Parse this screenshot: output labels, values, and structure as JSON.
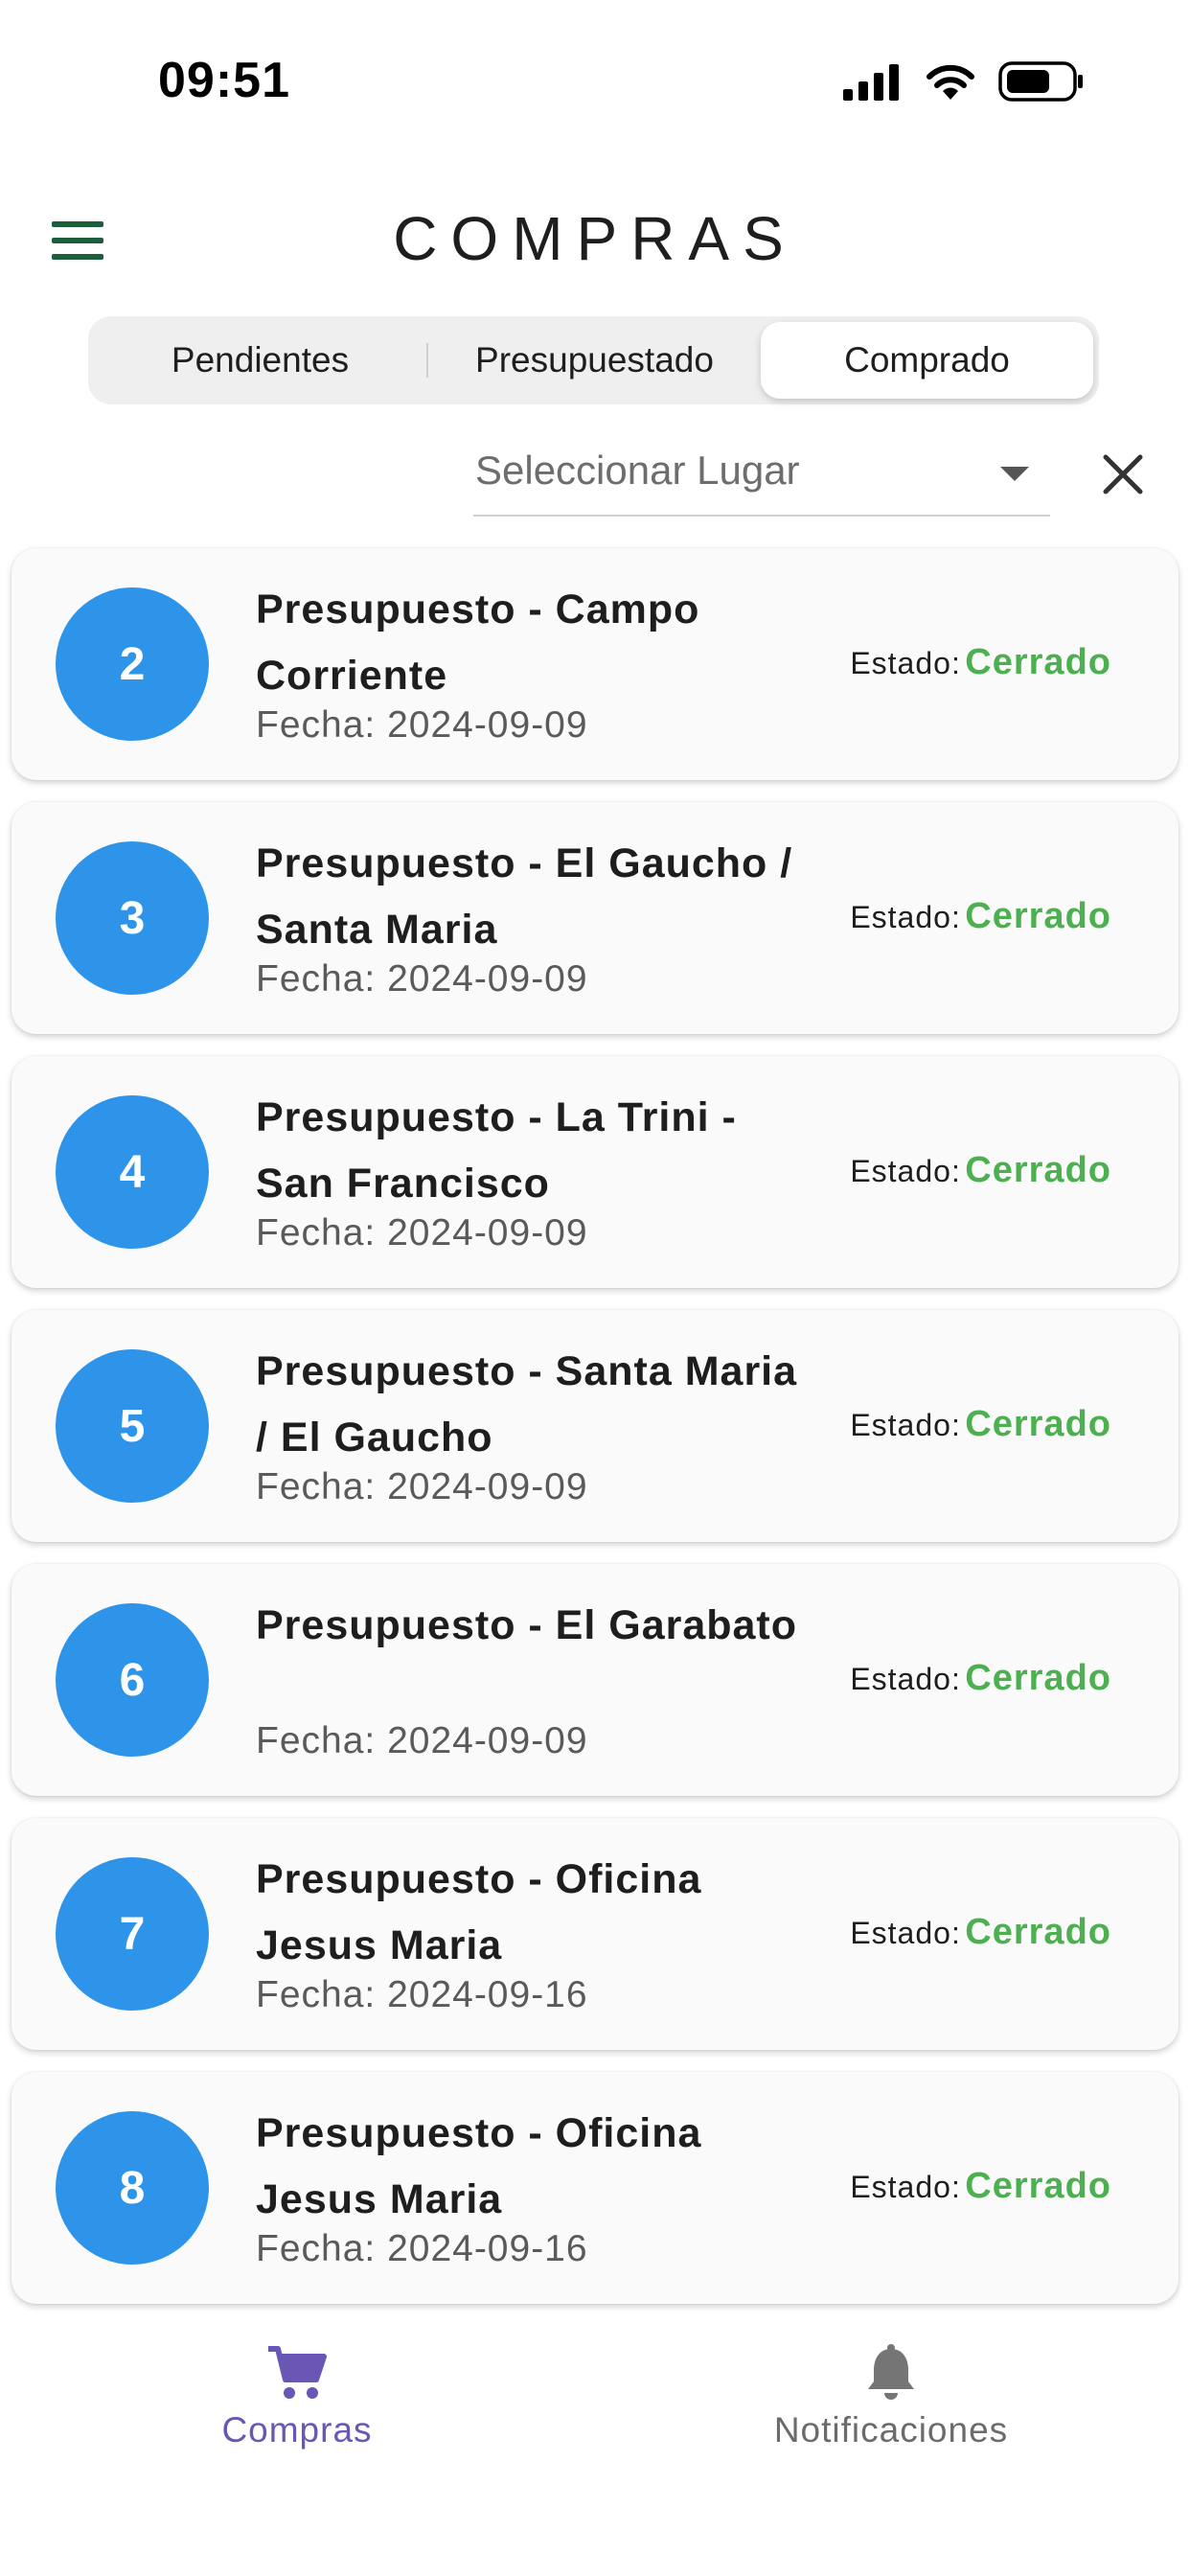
{
  "status_bar": {
    "time": "09:51",
    "icons": [
      "signal-icon",
      "wifi-icon",
      "battery-icon"
    ]
  },
  "header": {
    "title": "COMPRAS",
    "menu_icon": "menu-icon"
  },
  "tabs": [
    {
      "label": "Pendientes",
      "active": false
    },
    {
      "label": "Presupuestado",
      "active": false
    },
    {
      "label": "Comprado",
      "active": true
    }
  ],
  "filter": {
    "placeholder": "Seleccionar Lugar",
    "dropdown_icon": "caret-down-icon",
    "clear_icon": "close-icon"
  },
  "items": [
    {
      "number": "2",
      "title": "Presupuesto - Campo Corriente",
      "date": "Fecha: 2024-09-09",
      "status_label": "Estado:",
      "status_value": "Cerrado"
    },
    {
      "number": "3",
      "title": "Presupuesto - El Gaucho / Santa Maria",
      "date": "Fecha: 2024-09-09",
      "status_label": "Estado:",
      "status_value": "Cerrado"
    },
    {
      "number": "4",
      "title": "Presupuesto - La Trini - San Francisco",
      "date": "Fecha: 2024-09-09",
      "status_label": "Estado:",
      "status_value": "Cerrado"
    },
    {
      "number": "5",
      "title": "Presupuesto - Santa Maria / El Gaucho",
      "date": "Fecha: 2024-09-09",
      "status_label": "Estado:",
      "status_value": "Cerrado"
    },
    {
      "number": "6",
      "title": "Presupuesto - El Garabato",
      "date": "Fecha: 2024-09-09",
      "status_label": "Estado:",
      "status_value": "Cerrado"
    },
    {
      "number": "7",
      "title": "Presupuesto - Oficina Jesus Maria",
      "date": "Fecha: 2024-09-16",
      "status_label": "Estado:",
      "status_value": "Cerrado"
    },
    {
      "number": "8",
      "title": "Presupuesto - Oficina Jesus Maria",
      "date": "Fecha: 2024-09-16",
      "status_label": "Estado:",
      "status_value": "Cerrado"
    }
  ],
  "bottom_nav": [
    {
      "label": "Compras",
      "icon": "cart-icon",
      "active": true
    },
    {
      "label": "Notificaciones",
      "icon": "bell-icon",
      "active": false
    }
  ],
  "colors": {
    "accent": "#2d94ea",
    "status_closed": "#4caf50",
    "nav_active": "#6a56b4",
    "menu_icon": "#1b5e3b"
  }
}
